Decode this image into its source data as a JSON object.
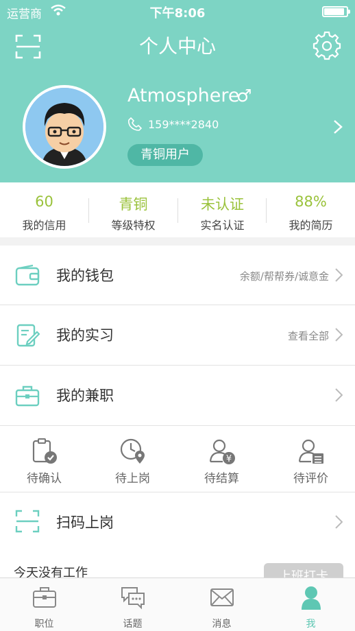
{
  "status_bar": {
    "carrier": "运营商",
    "time": "下午8:06",
    "battery_level": 0.9
  },
  "header": {
    "title": "个人中心",
    "username": "Atmosphere",
    "gender_symbol": "♂",
    "phone": "159****2840",
    "level_badge": "青铜用户",
    "scan_icon": "scan-icon",
    "settings_icon": "gear-icon"
  },
  "stats": [
    {
      "value": "60",
      "label": "我的信用"
    },
    {
      "value": "青铜",
      "label": "等级特权"
    },
    {
      "value": "未认证",
      "label": "实名认证"
    },
    {
      "value": "88%",
      "label": "我的简历"
    }
  ],
  "menu": {
    "wallet": {
      "label": "我的钱包",
      "sub": "余额/帮帮券/诚意金",
      "icon": "wallet-icon"
    },
    "internship": {
      "label": "我的实习",
      "sub": "查看全部",
      "icon": "edit-document-icon"
    },
    "parttime": {
      "label": "我的兼职",
      "icon": "briefcase-icon"
    }
  },
  "orders": [
    {
      "label": "待确认",
      "icon": "clipboard-check-icon"
    },
    {
      "label": "待上岗",
      "icon": "clock-location-icon"
    },
    {
      "label": "待结算",
      "icon": "user-yen-icon"
    },
    {
      "label": "待评价",
      "icon": "user-list-icon"
    }
  ],
  "scan_row": {
    "label": "扫码上岗",
    "icon": "scan-icon"
  },
  "today": {
    "text": "今天没有工作",
    "button": "上班打卡"
  },
  "tabs": [
    {
      "label": "职位",
      "icon": "briefcase-icon"
    },
    {
      "label": "话题",
      "icon": "chat-bubbles-icon"
    },
    {
      "label": "消息",
      "icon": "envelope-icon"
    },
    {
      "label": "我",
      "icon": "person-icon"
    }
  ],
  "colors": {
    "teal": "#7dd4c4",
    "accent_green": "#9ac23b",
    "tab_active": "#5ec7b3"
  }
}
